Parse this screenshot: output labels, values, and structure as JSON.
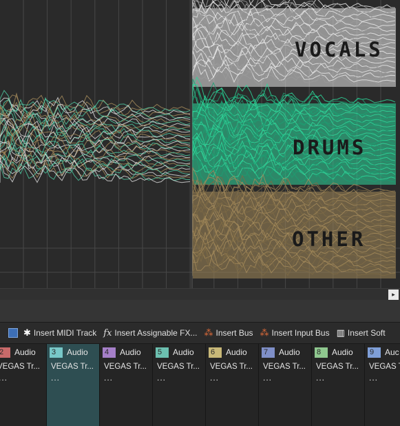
{
  "timeline": {
    "stems": [
      {
        "label": "VOCALS",
        "color": "#e8e8e8"
      },
      {
        "label": "DRUMS",
        "color": "#2fd69a"
      },
      {
        "label": "OTHER",
        "color": "#a3895a"
      }
    ],
    "background_color": "#2a2a2a",
    "grid_color": "#484848",
    "mixed_colors": [
      "#a3895a",
      "#4fc6a0",
      "#d8d8d8"
    ]
  },
  "scrollbar": {
    "right_arrow": "▸"
  },
  "toolbar": {
    "items": [
      {
        "icon": "midi-track-icon",
        "label": "Insert MIDI Track"
      },
      {
        "icon": "fx-icon",
        "label": "Insert Assignable FX..."
      },
      {
        "icon": "bus-icon",
        "label": "Insert Bus"
      },
      {
        "icon": "input-bus-icon",
        "label": "Insert Input Bus"
      },
      {
        "icon": "soft-synth-icon",
        "label": "Insert Soft"
      }
    ]
  },
  "tracks": [
    {
      "number": "2",
      "type": "Audio",
      "name": "VEGAS Tr...",
      "more": "...",
      "color": "#c96a6a"
    },
    {
      "number": "3",
      "type": "Audio",
      "name": "VEGAS Tr...",
      "more": "...",
      "color": "#78c8c8"
    },
    {
      "number": "4",
      "type": "Audio",
      "name": "VEGAS Tr...",
      "more": "...",
      "color": "#a57fc8"
    },
    {
      "number": "5",
      "type": "Audio",
      "name": "VEGAS Tr...",
      "more": "...",
      "color": "#6cc0b0"
    },
    {
      "number": "6",
      "type": "Audio",
      "name": "VEGAS Tr...",
      "more": "...",
      "color": "#c8b878"
    },
    {
      "number": "7",
      "type": "Audio",
      "name": "VEGAS Tr...",
      "more": "...",
      "color": "#7f8fc8"
    },
    {
      "number": "8",
      "type": "Audio",
      "name": "VEGAS Tr...",
      "more": "...",
      "color": "#8fc88f"
    },
    {
      "number": "9",
      "type": "Auc",
      "name": "VEGAS Tr",
      "more": "...",
      "color": "#7f9fd8"
    }
  ]
}
